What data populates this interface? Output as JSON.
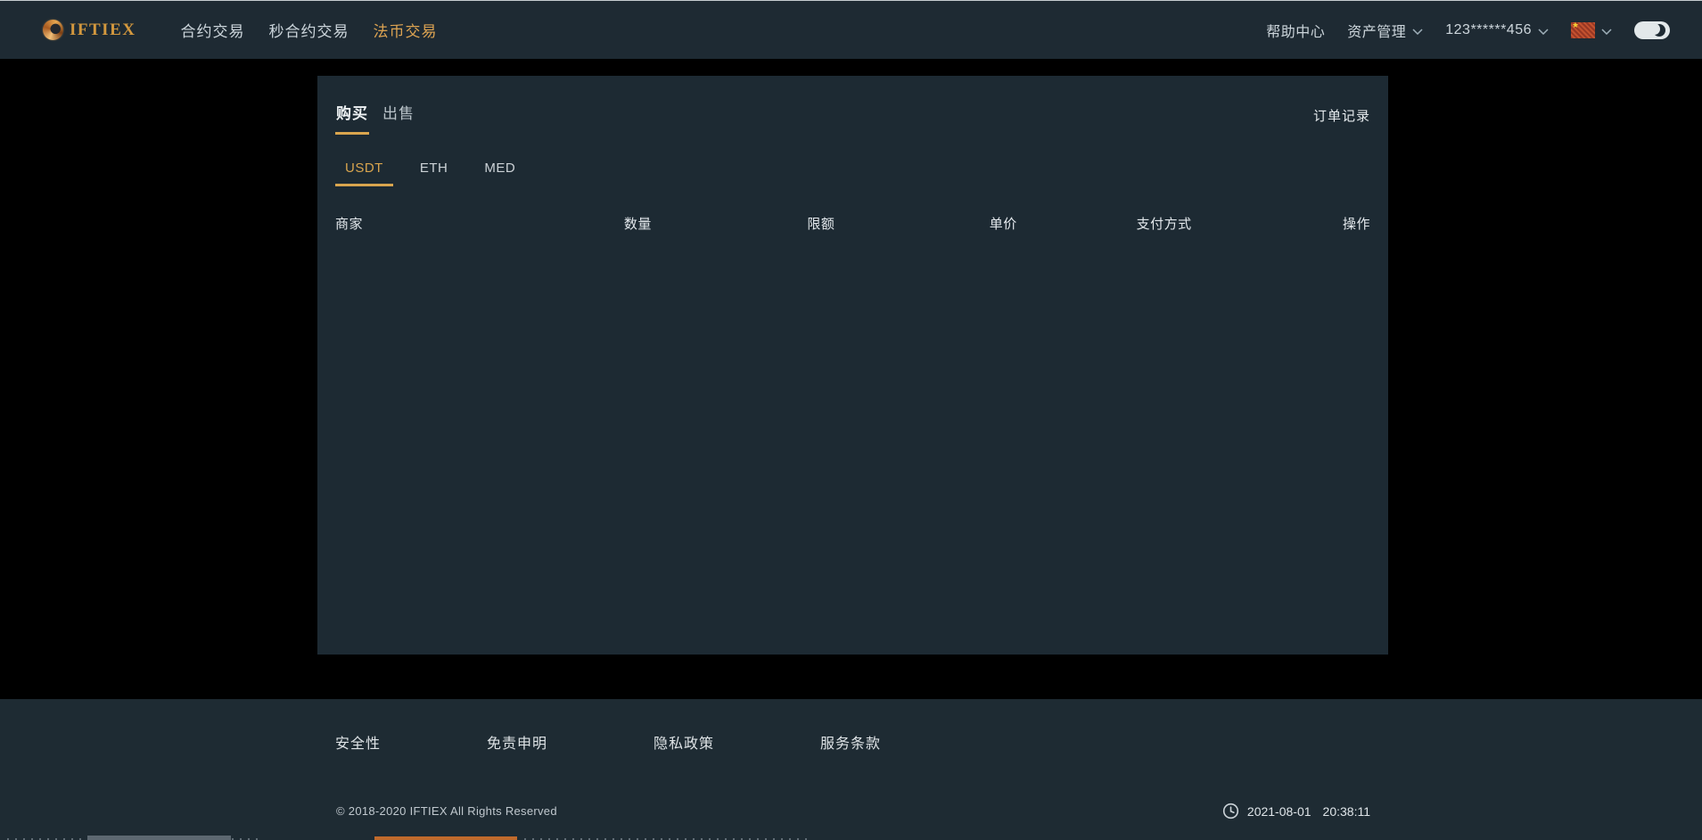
{
  "navbar": {
    "brand": "IFTIEX",
    "items": [
      {
        "label": "合约交易",
        "active": false
      },
      {
        "label": "秒合约交易",
        "active": false
      },
      {
        "label": "法币交易",
        "active": true
      }
    ],
    "help_center": "帮助中心",
    "asset_management": "资产管理",
    "account": "123******456",
    "language_icon": "china-flag-icon",
    "theme_toggle_icon": "moon-icon",
    "theme_toggle_state": "light"
  },
  "panel": {
    "tabs": [
      {
        "label": "购买",
        "active": true
      },
      {
        "label": "出售",
        "active": false
      }
    ],
    "order_records_label": "订单记录",
    "coin_tabs": [
      {
        "label": "USDT",
        "active": true
      },
      {
        "label": "ETH",
        "active": false
      },
      {
        "label": "MED",
        "active": false
      }
    ],
    "table": {
      "headers": [
        "商家",
        "数量",
        "限额",
        "单价",
        "支付方式",
        "操作"
      ],
      "rows": []
    }
  },
  "footer": {
    "links": [
      "安全性",
      "免责申明",
      "隐私政策",
      "服务条款"
    ],
    "copyright": "© 2018-2020 IFTIEX All Rights Reserved",
    "clock_icon": "clock-icon",
    "date": "2021-08-01",
    "time": "20:38:11"
  },
  "colors": {
    "background": "#000000",
    "surface": "#1d2a33",
    "navbar": "#1e2a33",
    "accent_gold": "#d9a54e",
    "nav_active": "#dca352",
    "text_primary": "#eef2f4",
    "text_muted": "#ccd5db",
    "toggle_bg": "#e2e8ea",
    "cutoff_orange": "#c06a2c",
    "cutoff_gray": "#5d6871"
  }
}
